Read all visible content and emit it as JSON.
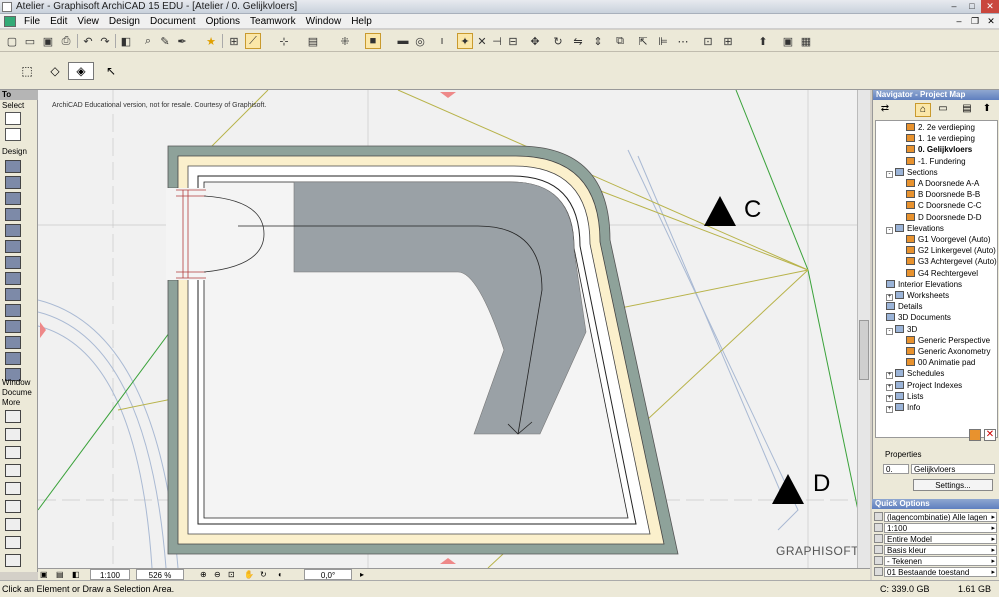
{
  "window": {
    "title": "Atelier - Graphisoft ArchiCAD 15 EDU - [Atelier / 0. Gelijkvloers]",
    "minimize": "–",
    "maximize": "□",
    "close": "✕"
  },
  "menu": [
    "File",
    "Edit",
    "View",
    "Design",
    "Document",
    "Options",
    "Teamwork",
    "Window",
    "Help"
  ],
  "toolbox": {
    "header": "To",
    "select": "Select",
    "design": "Design",
    "window": "Window",
    "docume": "Docume",
    "more": "More"
  },
  "canvas": {
    "note": "ArchiCAD Educational version, not for resale. Courtesy of Graphisoft.",
    "marker_c": "C",
    "marker_d": "D",
    "logo": "GRAPHISOFT."
  },
  "bottombar": {
    "scale": "1:100",
    "zoom": "526 %",
    "angle": "0,0°"
  },
  "status": {
    "message": "Click an Element or Draw a Selection Area.",
    "disk": "C: 339.0 GB",
    "memory": "1.61 GB"
  },
  "navigator": {
    "title": "Navigator - Project Map",
    "items": [
      {
        "label": "2. 2e verdieping",
        "indent": 3,
        "icon": "orange",
        "bold": false
      },
      {
        "label": "1. 1e verdieping",
        "indent": 3,
        "icon": "orange",
        "bold": false
      },
      {
        "label": "0. Gelijkvloers",
        "indent": 3,
        "icon": "orange",
        "bold": true
      },
      {
        "label": "-1. Fundering",
        "indent": 3,
        "icon": "orange",
        "bold": false
      },
      {
        "label": "Sections",
        "indent": 1,
        "icon": "folder",
        "bold": false,
        "exp": "-"
      },
      {
        "label": "A Doorsnede A-A",
        "indent": 3,
        "icon": "orange",
        "bold": false
      },
      {
        "label": "B Doorsnede B-B",
        "indent": 3,
        "icon": "orange",
        "bold": false
      },
      {
        "label": "C Doorsnede C-C",
        "indent": 3,
        "icon": "orange",
        "bold": false
      },
      {
        "label": "D Doorsnede D-D",
        "indent": 3,
        "icon": "orange",
        "bold": false
      },
      {
        "label": "Elevations",
        "indent": 1,
        "icon": "folder",
        "bold": false,
        "exp": "-"
      },
      {
        "label": "G1 Voorgevel (Auto)",
        "indent": 3,
        "icon": "orange",
        "bold": false
      },
      {
        "label": "G2 Linkergevel (Auto)",
        "indent": 3,
        "icon": "orange",
        "bold": false
      },
      {
        "label": "G3 Achtergevel (Auto)",
        "indent": 3,
        "icon": "orange",
        "bold": false
      },
      {
        "label": "G4 Rechtergevel",
        "indent": 3,
        "icon": "orange",
        "bold": false
      },
      {
        "label": "Interior Elevations",
        "indent": 1,
        "icon": "folder",
        "bold": false
      },
      {
        "label": "Worksheets",
        "indent": 1,
        "icon": "folder",
        "bold": false,
        "exp": "+"
      },
      {
        "label": "Details",
        "indent": 1,
        "icon": "folder",
        "bold": false
      },
      {
        "label": "3D Documents",
        "indent": 1,
        "icon": "folder",
        "bold": false
      },
      {
        "label": "3D",
        "indent": 1,
        "icon": "folder",
        "bold": false,
        "exp": "-"
      },
      {
        "label": "Generic Perspective",
        "indent": 3,
        "icon": "orange",
        "bold": false
      },
      {
        "label": "Generic Axonometry",
        "indent": 3,
        "icon": "orange",
        "bold": false
      },
      {
        "label": "00 Animatie pad",
        "indent": 3,
        "icon": "orange",
        "bold": false
      },
      {
        "label": "Schedules",
        "indent": 1,
        "icon": "folder",
        "bold": false,
        "exp": "+"
      },
      {
        "label": "Project Indexes",
        "indent": 1,
        "icon": "folder",
        "bold": false,
        "exp": "+"
      },
      {
        "label": "Lists",
        "indent": 1,
        "icon": "folder",
        "bold": false,
        "exp": "+"
      },
      {
        "label": "Info",
        "indent": 1,
        "icon": "folder",
        "bold": false,
        "exp": "+"
      }
    ],
    "properties_label": "Properties",
    "prop_num": "0.",
    "prop_name": "Gelijkvloers",
    "settings": "Settings..."
  },
  "quick_options": {
    "title": "Quick Options",
    "rows": [
      "(lagencombinatie) Alle lagen",
      "1:100",
      "Entire Model",
      "Basis kleur",
      "- Tekenen",
      "01 Bestaande toestand"
    ]
  }
}
